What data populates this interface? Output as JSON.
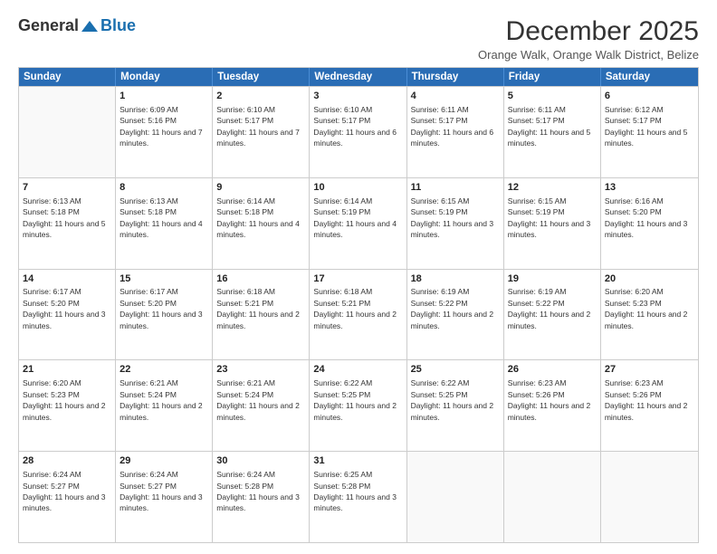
{
  "logo": {
    "general": "General",
    "blue": "Blue"
  },
  "title": "December 2025",
  "location": "Orange Walk, Orange Walk District, Belize",
  "header_days": [
    "Sunday",
    "Monday",
    "Tuesday",
    "Wednesday",
    "Thursday",
    "Friday",
    "Saturday"
  ],
  "rows": [
    [
      {
        "day": "",
        "sunrise": "",
        "sunset": "",
        "daylight": ""
      },
      {
        "day": "1",
        "sunrise": "Sunrise: 6:09 AM",
        "sunset": "Sunset: 5:16 PM",
        "daylight": "Daylight: 11 hours and 7 minutes."
      },
      {
        "day": "2",
        "sunrise": "Sunrise: 6:10 AM",
        "sunset": "Sunset: 5:17 PM",
        "daylight": "Daylight: 11 hours and 7 minutes."
      },
      {
        "day": "3",
        "sunrise": "Sunrise: 6:10 AM",
        "sunset": "Sunset: 5:17 PM",
        "daylight": "Daylight: 11 hours and 6 minutes."
      },
      {
        "day": "4",
        "sunrise": "Sunrise: 6:11 AM",
        "sunset": "Sunset: 5:17 PM",
        "daylight": "Daylight: 11 hours and 6 minutes."
      },
      {
        "day": "5",
        "sunrise": "Sunrise: 6:11 AM",
        "sunset": "Sunset: 5:17 PM",
        "daylight": "Daylight: 11 hours and 5 minutes."
      },
      {
        "day": "6",
        "sunrise": "Sunrise: 6:12 AM",
        "sunset": "Sunset: 5:17 PM",
        "daylight": "Daylight: 11 hours and 5 minutes."
      }
    ],
    [
      {
        "day": "7",
        "sunrise": "Sunrise: 6:13 AM",
        "sunset": "Sunset: 5:18 PM",
        "daylight": "Daylight: 11 hours and 5 minutes."
      },
      {
        "day": "8",
        "sunrise": "Sunrise: 6:13 AM",
        "sunset": "Sunset: 5:18 PM",
        "daylight": "Daylight: 11 hours and 4 minutes."
      },
      {
        "day": "9",
        "sunrise": "Sunrise: 6:14 AM",
        "sunset": "Sunset: 5:18 PM",
        "daylight": "Daylight: 11 hours and 4 minutes."
      },
      {
        "day": "10",
        "sunrise": "Sunrise: 6:14 AM",
        "sunset": "Sunset: 5:19 PM",
        "daylight": "Daylight: 11 hours and 4 minutes."
      },
      {
        "day": "11",
        "sunrise": "Sunrise: 6:15 AM",
        "sunset": "Sunset: 5:19 PM",
        "daylight": "Daylight: 11 hours and 3 minutes."
      },
      {
        "day": "12",
        "sunrise": "Sunrise: 6:15 AM",
        "sunset": "Sunset: 5:19 PM",
        "daylight": "Daylight: 11 hours and 3 minutes."
      },
      {
        "day": "13",
        "sunrise": "Sunrise: 6:16 AM",
        "sunset": "Sunset: 5:20 PM",
        "daylight": "Daylight: 11 hours and 3 minutes."
      }
    ],
    [
      {
        "day": "14",
        "sunrise": "Sunrise: 6:17 AM",
        "sunset": "Sunset: 5:20 PM",
        "daylight": "Daylight: 11 hours and 3 minutes."
      },
      {
        "day": "15",
        "sunrise": "Sunrise: 6:17 AM",
        "sunset": "Sunset: 5:20 PM",
        "daylight": "Daylight: 11 hours and 3 minutes."
      },
      {
        "day": "16",
        "sunrise": "Sunrise: 6:18 AM",
        "sunset": "Sunset: 5:21 PM",
        "daylight": "Daylight: 11 hours and 2 minutes."
      },
      {
        "day": "17",
        "sunrise": "Sunrise: 6:18 AM",
        "sunset": "Sunset: 5:21 PM",
        "daylight": "Daylight: 11 hours and 2 minutes."
      },
      {
        "day": "18",
        "sunrise": "Sunrise: 6:19 AM",
        "sunset": "Sunset: 5:22 PM",
        "daylight": "Daylight: 11 hours and 2 minutes."
      },
      {
        "day": "19",
        "sunrise": "Sunrise: 6:19 AM",
        "sunset": "Sunset: 5:22 PM",
        "daylight": "Daylight: 11 hours and 2 minutes."
      },
      {
        "day": "20",
        "sunrise": "Sunrise: 6:20 AM",
        "sunset": "Sunset: 5:23 PM",
        "daylight": "Daylight: 11 hours and 2 minutes."
      }
    ],
    [
      {
        "day": "21",
        "sunrise": "Sunrise: 6:20 AM",
        "sunset": "Sunset: 5:23 PM",
        "daylight": "Daylight: 11 hours and 2 minutes."
      },
      {
        "day": "22",
        "sunrise": "Sunrise: 6:21 AM",
        "sunset": "Sunset: 5:24 PM",
        "daylight": "Daylight: 11 hours and 2 minutes."
      },
      {
        "day": "23",
        "sunrise": "Sunrise: 6:21 AM",
        "sunset": "Sunset: 5:24 PM",
        "daylight": "Daylight: 11 hours and 2 minutes."
      },
      {
        "day": "24",
        "sunrise": "Sunrise: 6:22 AM",
        "sunset": "Sunset: 5:25 PM",
        "daylight": "Daylight: 11 hours and 2 minutes."
      },
      {
        "day": "25",
        "sunrise": "Sunrise: 6:22 AM",
        "sunset": "Sunset: 5:25 PM",
        "daylight": "Daylight: 11 hours and 2 minutes."
      },
      {
        "day": "26",
        "sunrise": "Sunrise: 6:23 AM",
        "sunset": "Sunset: 5:26 PM",
        "daylight": "Daylight: 11 hours and 2 minutes."
      },
      {
        "day": "27",
        "sunrise": "Sunrise: 6:23 AM",
        "sunset": "Sunset: 5:26 PM",
        "daylight": "Daylight: 11 hours and 2 minutes."
      }
    ],
    [
      {
        "day": "28",
        "sunrise": "Sunrise: 6:24 AM",
        "sunset": "Sunset: 5:27 PM",
        "daylight": "Daylight: 11 hours and 3 minutes."
      },
      {
        "day": "29",
        "sunrise": "Sunrise: 6:24 AM",
        "sunset": "Sunset: 5:27 PM",
        "daylight": "Daylight: 11 hours and 3 minutes."
      },
      {
        "day": "30",
        "sunrise": "Sunrise: 6:24 AM",
        "sunset": "Sunset: 5:28 PM",
        "daylight": "Daylight: 11 hours and 3 minutes."
      },
      {
        "day": "31",
        "sunrise": "Sunrise: 6:25 AM",
        "sunset": "Sunset: 5:28 PM",
        "daylight": "Daylight: 11 hours and 3 minutes."
      },
      {
        "day": "",
        "sunrise": "",
        "sunset": "",
        "daylight": ""
      },
      {
        "day": "",
        "sunrise": "",
        "sunset": "",
        "daylight": ""
      },
      {
        "day": "",
        "sunrise": "",
        "sunset": "",
        "daylight": ""
      }
    ]
  ]
}
